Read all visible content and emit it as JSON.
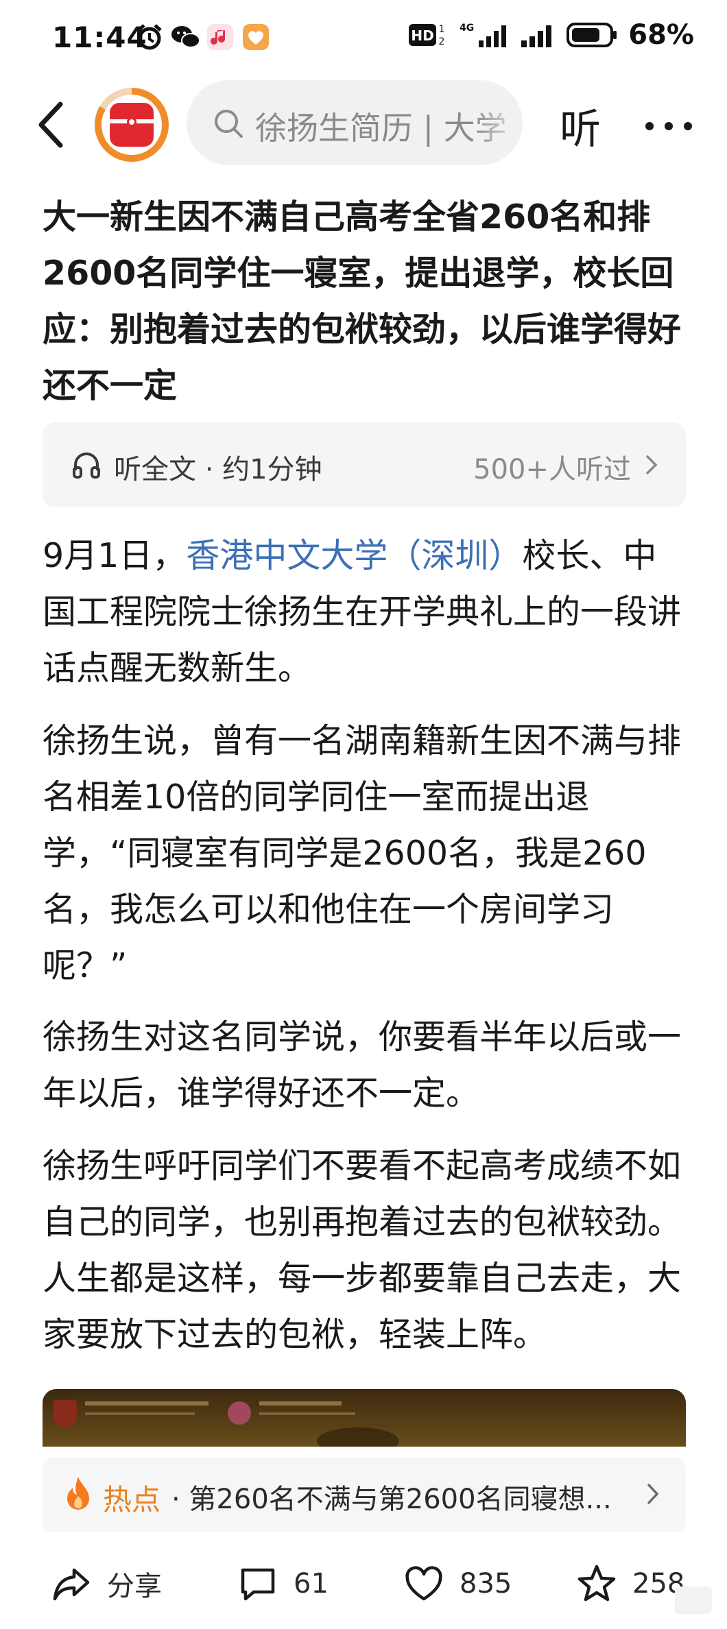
{
  "status_bar": {
    "time": "11:44",
    "battery": "68%",
    "network": "4G",
    "hd_label": "HD"
  },
  "nav": {
    "search_text": "徐扬生简历 | 大学",
    "listen_label": "听",
    "more_label": "···"
  },
  "article": {
    "title": "大一新生因不满自己高考全省260名和排2600名同学住一寝室，提出退学，校长回应：别抱着过去的包袱较劲，以后谁学得好还不一定",
    "listen_bar": {
      "label": "听全文 · 约1分钟",
      "count": "500+人听过"
    },
    "paragraphs": {
      "p1_prefix": "9月1日，",
      "p1_link": "香港中文大学（深圳）",
      "p1_suffix": "校长、中国工程院院士徐扬生在开学典礼上的一段讲话点醒无数新生。",
      "p2": "徐扬生说，曾有一名湖南籍新生因不满与排名相差10倍的同学同住一室而提出退学，“同寝室有同学是2600名，我是260名，我怎么可以和他住在一个房间学习呢？”",
      "p3": "徐扬生对这名同学说，你要看半年以后或一年以后，谁学得好还不一定。",
      "p4": "徐扬生呼吁同学们不要看不起高考成绩不如自己的同学，也别再抱着过去的包袱较劲。人生都是这样，每一步都要靠自己去走，大家要放下过去的包袱，轻装上阵。"
    },
    "hot": {
      "label": "热点",
      "text": "· 第260名不满与第2600名同寝想..."
    }
  },
  "actions": {
    "share": "分享",
    "comments": "61",
    "likes": "835",
    "favorites": "258"
  },
  "colors": {
    "link": "#3b6fb6",
    "hot": "#e9821c",
    "logo_red": "#e0292f",
    "logo_ring": "#f08c2a"
  }
}
